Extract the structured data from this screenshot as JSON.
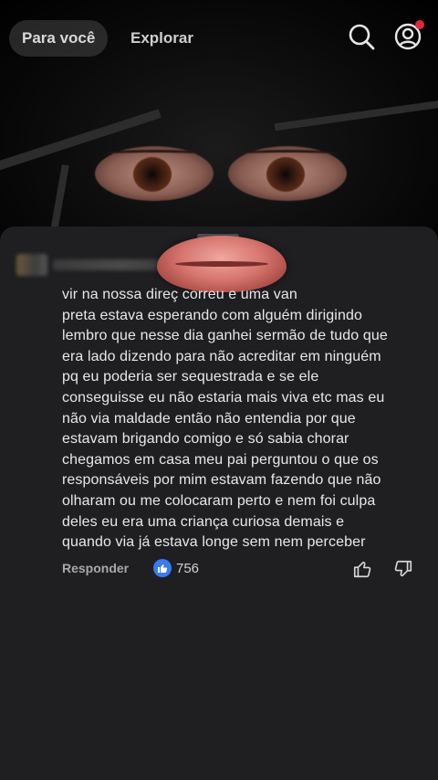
{
  "top_nav": {
    "tab_active": "Para você",
    "tab_inactive": "Explorar",
    "search_icon": "search-icon",
    "profile_icon": "user-circle-icon",
    "notification_color": "#e0283d"
  },
  "comment": {
    "text": "vir na nossa direç          correu e uma van\npreta estava esperando com alguém dirigindo\nlembro que nesse dia ganhei sermão de tudo que\nera lado dizendo para não acreditar em ninguém\npq eu poderia ser sequestrada e se ele\nconseguisse eu não estaria mais viva etc mas eu\nnão via maldade então não entendia por que\nestavam brigando comigo e só sabia chorar\nchegamos em casa meu pai perguntou o que os\nresponsáveis por mim estavam fazendo que não\nolharam ou me colocaram perto e nem foi culpa\ndeles eu era uma criança curiosa demais e\nquando via já estava longe sem nem perceber",
    "reply_label": "Responder",
    "like_count": "756",
    "like_color": "#3a7af2"
  }
}
